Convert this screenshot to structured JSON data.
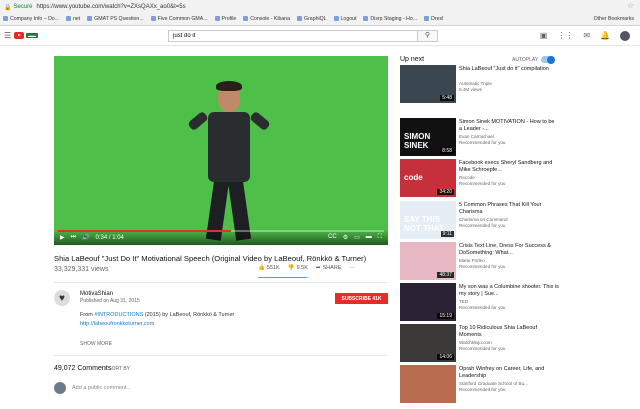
{
  "browser": {
    "secure_label": "Secure",
    "url": "https://www.youtube.com/watch?v=ZXsQAXx_ao0&t=5s",
    "bookmarks": [
      "Company Info – Do...",
      "net",
      "GMAT PS Question...",
      "Five Common GMA...",
      "Profile",
      "Console - Kibana",
      "GraphiQL",
      "Logout",
      "Disrp Staging - Ho...",
      "Drexl"
    ],
    "other_bookmarks": "Other Bookmarks"
  },
  "youtube": {
    "search_value": "just do it",
    "video": {
      "time_current": "0:34",
      "time_total": "1:04",
      "progress": 0.53,
      "title": "Shia LaBeouf \"Just Do It\" Motivational Speech (Original Video by LaBeouf, Rönkkö & Turner)",
      "views": "33,329,331 views",
      "likes": "551K",
      "dislikes": "9.5K",
      "like_ratio": 0.98,
      "share": "SHARE",
      "more": "···"
    },
    "channel": {
      "name": "MotivaShian",
      "published": "Published on Aug 31, 2015",
      "subscribe": "SUBSCRIBE 41K",
      "desc_from": "From",
      "desc_link": "#INTRODUCTIONS",
      "desc_rest": "(2015) by LaBeouf, Rönkkö & Turner",
      "desc_url": "http://labeoufronkkoturner.com",
      "show_more": "SHOW MORE"
    },
    "comments": {
      "count": "49,072 Comments",
      "sort": "SORT BY",
      "placeholder": "Add a public comment..."
    },
    "sidebar": {
      "up_next": "Up next",
      "autoplay": "AUTOPLAY",
      "items": [
        {
          "title": "Shia LaBeouf \"Just do it\" compilation",
          "channel": "Automatic Triple",
          "meta": "5.4M views",
          "duration": "5:48",
          "thumb_color": "#3a4650",
          "thumb_text": ""
        },
        {
          "title": "Simon Sinek MOTIVATION - How to be a Leader -...",
          "channel": "Evan Carmichael",
          "meta": "Recommended for you",
          "duration": "8:58",
          "thumb_color": "#111111",
          "thumb_text": "SIMON SINEK"
        },
        {
          "title": "Facebook execs Sheryl Sandberg and Mike Schroepfe...",
          "channel": "Recode",
          "meta": "Recommended for you",
          "duration": "34:20",
          "thumb_color": "#c6303a",
          "thumb_text": "code"
        },
        {
          "title": "5 Common Phrases That Kill Your Charisma",
          "channel": "Charisma on Command",
          "meta": "Recommended for you",
          "duration": "9:11",
          "thumb_color": "#e5eef5",
          "thumb_text": "SAY THIS NOT THAT"
        },
        {
          "title": "Crisis Text Line, Dress For Success & DoSomething: What...",
          "channel": "Marie Forleo",
          "meta": "Recommended for you",
          "duration": "48:37",
          "thumb_color": "#e7b8c3",
          "thumb_text": ""
        },
        {
          "title": "My son was a Columbine shooter. This is my story | Sue...",
          "channel": "TED",
          "meta": "Recommended for you",
          "duration": "15:19",
          "thumb_color": "#2b2236",
          "thumb_text": ""
        },
        {
          "title": "Top 10 Ridiculous Shia LaBeouf Moments",
          "channel": "WatchMojo.com",
          "meta": "Recommended for you",
          "duration": "14:06",
          "thumb_color": "#3c3a38",
          "thumb_text": ""
        },
        {
          "title": "Oprah Winfrey on Career, Life, and Leadership",
          "channel": "Stanford Graduate School of Bu...",
          "meta": "Recommended for you",
          "duration": "",
          "thumb_color": "#b96c4f",
          "thumb_text": ""
        }
      ]
    }
  }
}
